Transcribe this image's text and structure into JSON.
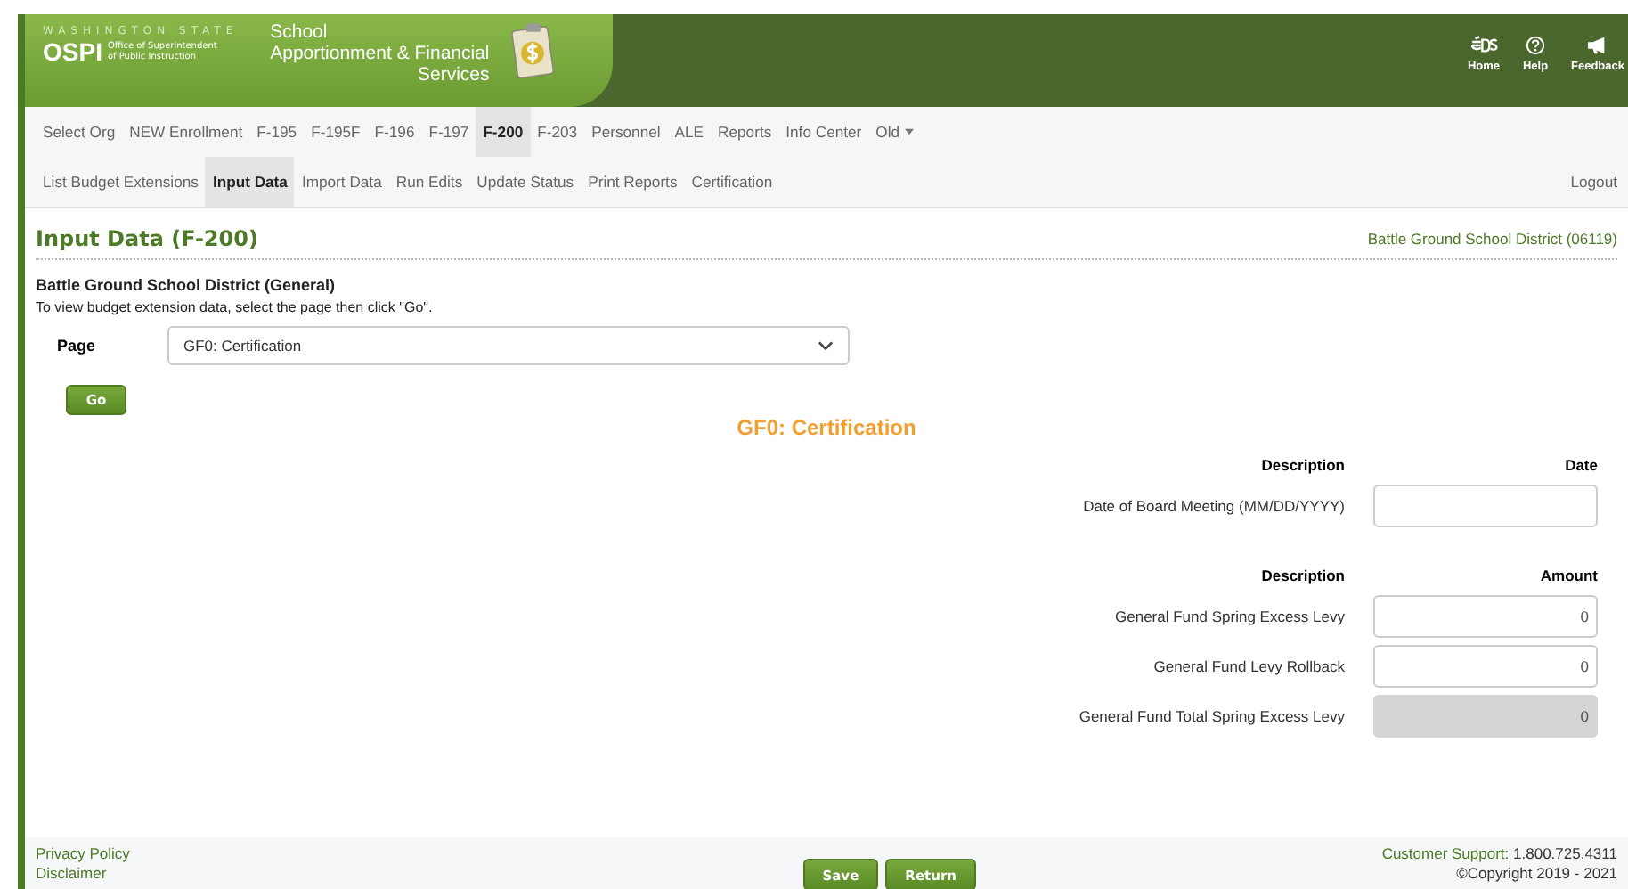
{
  "header": {
    "state_label": "WASHINGTON STATE",
    "agency": "OSPI",
    "agency_sub": [
      "Office of Superintendent",
      "of Public Instruction"
    ],
    "app_title": [
      "School",
      "Apportionment & Financial",
      "Services"
    ],
    "links": [
      {
        "label": "Home",
        "kind": "eds"
      },
      {
        "label": "Help",
        "kind": "help"
      },
      {
        "label": "Feedback",
        "kind": "feedback"
      }
    ]
  },
  "main_nav": [
    {
      "label": "Select Org",
      "selected": false,
      "has_menu": false
    },
    {
      "label": "NEW Enrollment",
      "selected": false,
      "has_menu": false
    },
    {
      "label": "F-195",
      "selected": false,
      "has_menu": false
    },
    {
      "label": "F-195F",
      "selected": false,
      "has_menu": false
    },
    {
      "label": "F-196",
      "selected": false,
      "has_menu": false
    },
    {
      "label": "F-197",
      "selected": false,
      "has_menu": false
    },
    {
      "label": "F-200",
      "selected": true,
      "has_menu": false
    },
    {
      "label": "F-203",
      "selected": false,
      "has_menu": false
    },
    {
      "label": "Personnel",
      "selected": false,
      "has_menu": false
    },
    {
      "label": "ALE",
      "selected": false,
      "has_menu": false
    },
    {
      "label": "Reports",
      "selected": false,
      "has_menu": false
    },
    {
      "label": "Info Center",
      "selected": false,
      "has_menu": false
    },
    {
      "label": "Old",
      "selected": false,
      "has_menu": true
    }
  ],
  "sub_nav": [
    {
      "label": "List Budget Extensions",
      "selected": false
    },
    {
      "label": "Input Data",
      "selected": true
    },
    {
      "label": "Import Data",
      "selected": false
    },
    {
      "label": "Run Edits",
      "selected": false
    },
    {
      "label": "Update Status",
      "selected": false
    },
    {
      "label": "Print Reports",
      "selected": false
    },
    {
      "label": "Certification",
      "selected": false
    }
  ],
  "logout": "Logout",
  "page": {
    "title": "Input Data (F-200)",
    "org": "Battle Ground School District (06119)",
    "section": "Battle Ground School District (General)",
    "instruction": "To view budget extension data, select the page then click \"Go\".",
    "page_label": "Page",
    "page_value": "GF0: Certification",
    "go": "Go"
  },
  "form": {
    "title": "GF0: Certification",
    "groups": [
      {
        "description_header": "Description",
        "value_header": "Date",
        "rows": [
          {
            "label": "Date of Board Meeting (MM/DD/YYYY)",
            "disabled": false
          }
        ]
      },
      {
        "description_header": "Description",
        "value_header": "Amount",
        "rows": [
          {
            "label": "General Fund Spring Excess Levy",
            "value": "0",
            "disabled": false
          },
          {
            "label": "General Fund Levy Rollback",
            "value": "0",
            "disabled": false
          },
          {
            "label": "General Fund Total Spring Excess Levy",
            "value": "0",
            "disabled": true
          }
        ]
      }
    ]
  },
  "footer": {
    "links": [
      "Privacy Policy",
      "Disclaimer"
    ],
    "buttons": [
      "Save",
      "Return"
    ],
    "support_label": "Customer Support:",
    "support_phone": "1.800.725.4311",
    "copyright": "©Copyright 2019 - 2021"
  }
}
